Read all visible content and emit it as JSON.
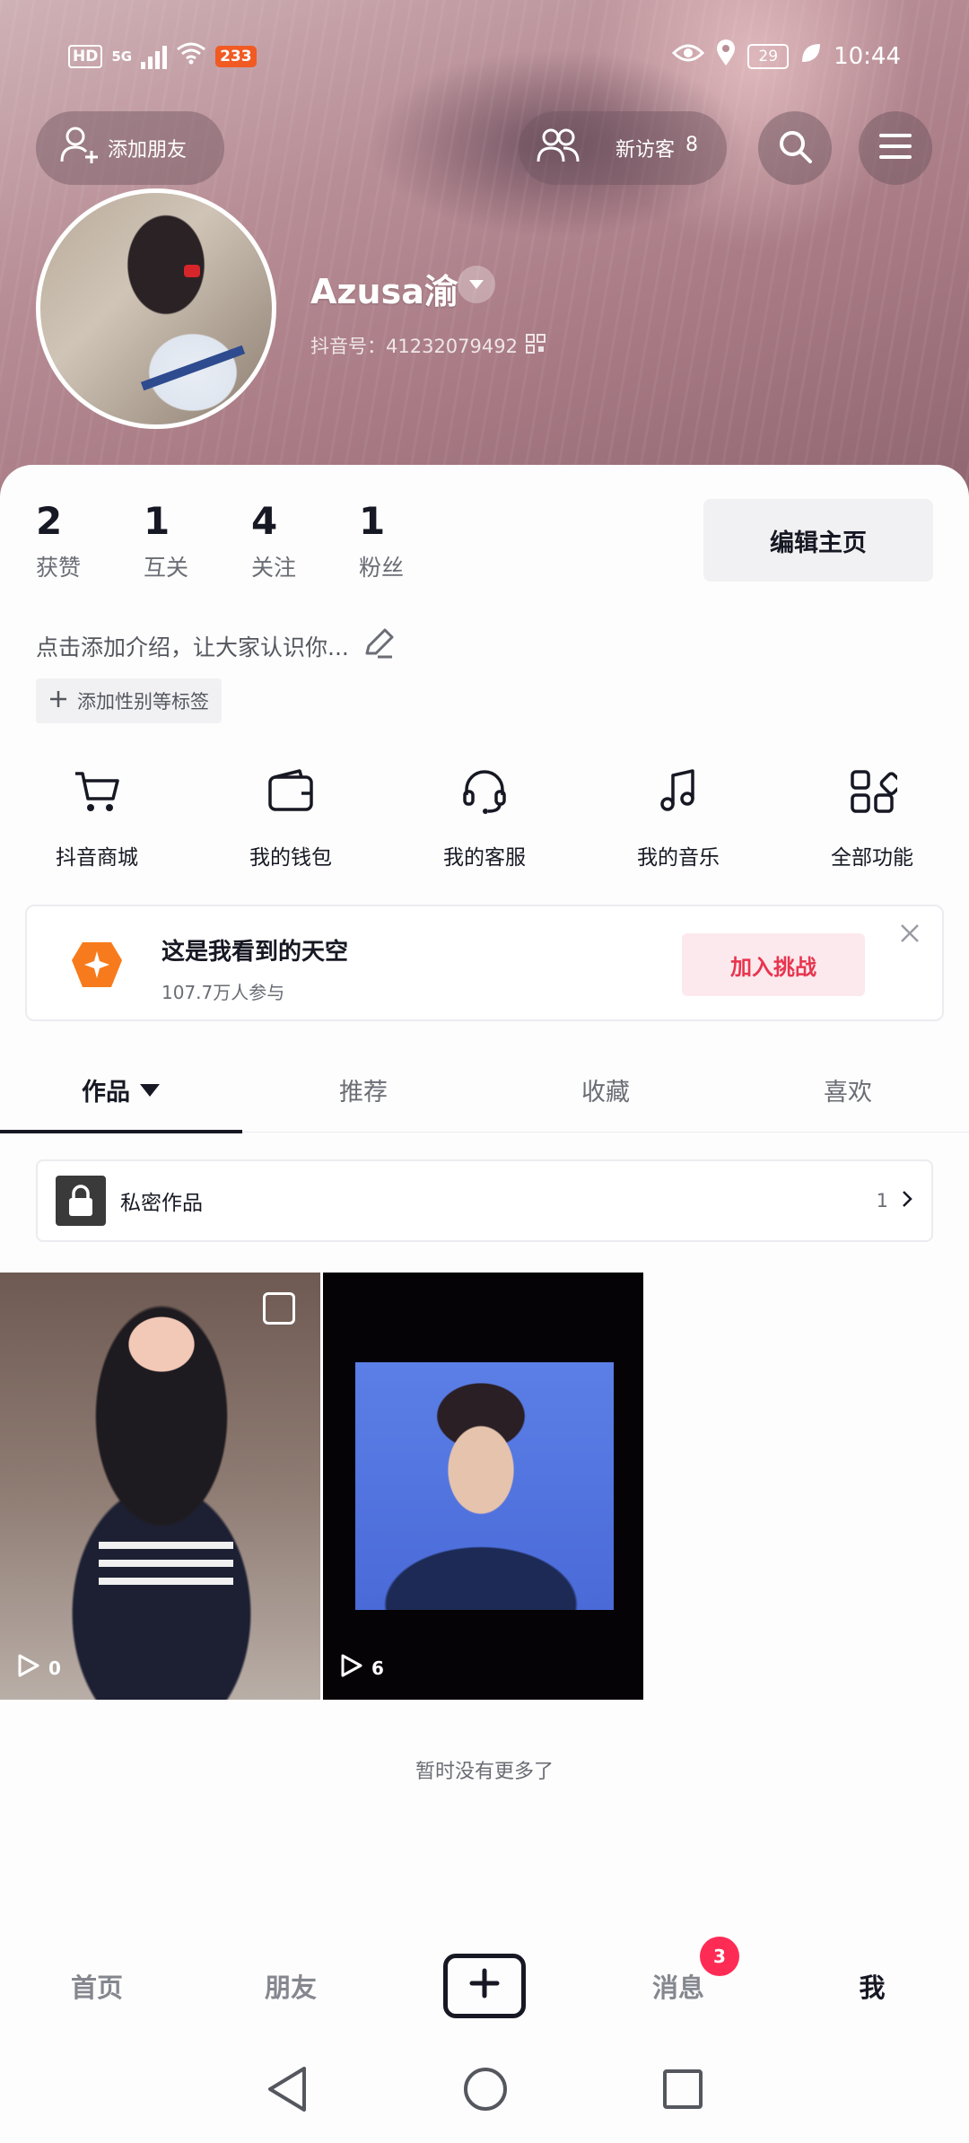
{
  "status_bar": {
    "network_hd": "HD",
    "network_5g": "5G",
    "notification_count": "233",
    "battery": "29",
    "time": "10:44"
  },
  "header": {
    "add_friend_label": "添加朋友",
    "visitor_label": "新访客",
    "visitor_count": "8",
    "username": "Azusa渝",
    "douyin_id": "抖音号：41232079492"
  },
  "stats": [
    {
      "value": "2",
      "label": "获赞"
    },
    {
      "value": "1",
      "label": "互关"
    },
    {
      "value": "4",
      "label": "关注"
    },
    {
      "value": "1",
      "label": "粉丝"
    }
  ],
  "edit_profile_label": "编辑主页",
  "bio_placeholder": "点击添加介绍，让大家认识你...",
  "add_tags_label": "添加性别等标签",
  "features": [
    {
      "icon": "cart-icon",
      "label": "抖音商城"
    },
    {
      "icon": "wallet-icon",
      "label": "我的钱包"
    },
    {
      "icon": "headset-icon",
      "label": "我的客服"
    },
    {
      "icon": "music-note-icon",
      "label": "我的音乐"
    },
    {
      "icon": "grid-apps-icon",
      "label": "全部功能"
    }
  ],
  "challenge": {
    "title": "这是我看到的天空",
    "participants": "107.7万人参与",
    "join_label": "加入挑战",
    "accent_color": "#e8354f"
  },
  "tabs": [
    {
      "label": "作品",
      "active": true
    },
    {
      "label": "推荐",
      "active": false
    },
    {
      "label": "收藏",
      "active": false
    },
    {
      "label": "喜欢",
      "active": false
    }
  ],
  "private_works": {
    "label": "私密作品",
    "count": "1"
  },
  "videos": [
    {
      "plays": "0"
    },
    {
      "plays": "6"
    }
  ],
  "no_more_text": "暂时没有更多了",
  "bottom_nav": {
    "home": "首页",
    "friends": "朋友",
    "messages": "消息",
    "messages_badge": "3",
    "me": "我"
  }
}
